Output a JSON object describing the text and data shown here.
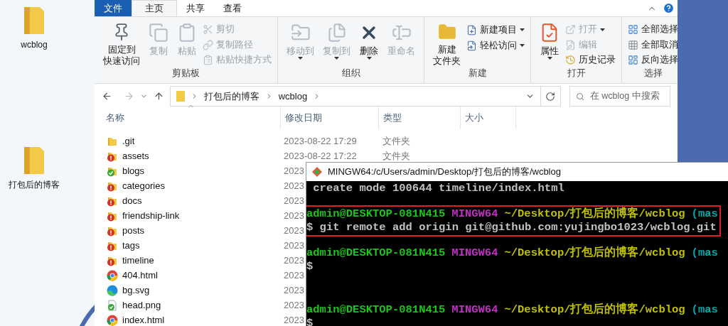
{
  "desktop_icons": [
    {
      "label": "wcblog"
    },
    {
      "label": "打包后的博客"
    }
  ],
  "explorer": {
    "tabs": [
      {
        "label": "文件",
        "kind": "file",
        "selected": false
      },
      {
        "label": "主页",
        "kind": "tab",
        "selected": true
      },
      {
        "label": "共享",
        "kind": "tab",
        "selected": false
      },
      {
        "label": "查看",
        "kind": "tab",
        "selected": false
      }
    ],
    "ribbon": {
      "groups": [
        {
          "label": "剪贴板",
          "buttons": [
            {
              "lines": [
                "固定到",
                "快速访问"
              ],
              "kind": "large",
              "disabled": false,
              "dropdown": false
            },
            {
              "lines": [
                "复制"
              ],
              "kind": "large",
              "disabled": true,
              "dropdown": false
            },
            {
              "lines": [
                "粘贴"
              ],
              "kind": "large",
              "disabled": true,
              "dropdown": false
            },
            {
              "lines": [
                "剪切"
              ],
              "kind": "small",
              "disabled": true,
              "dropdown": false
            },
            {
              "lines": [
                "复制路径"
              ],
              "kind": "small",
              "disabled": true,
              "dropdown": false
            },
            {
              "lines": [
                "粘贴快捷方式"
              ],
              "kind": "small",
              "disabled": true,
              "dropdown": false
            }
          ]
        },
        {
          "label": "组织",
          "buttons": [
            {
              "lines": [
                "移动到"
              ],
              "kind": "large",
              "disabled": true,
              "dropdown": true
            },
            {
              "lines": [
                "复制到"
              ],
              "kind": "large",
              "disabled": true,
              "dropdown": true
            },
            {
              "lines": [
                "删除"
              ],
              "kind": "large",
              "disabled": false,
              "dropdown": true
            },
            {
              "lines": [
                "重命名"
              ],
              "kind": "large",
              "disabled": true,
              "dropdown": false
            }
          ]
        },
        {
          "label": "新建",
          "buttons": [
            {
              "lines": [
                "新建",
                "文件夹"
              ],
              "kind": "large",
              "disabled": false,
              "dropdown": false
            },
            {
              "lines": [
                "新建项目"
              ],
              "kind": "small",
              "disabled": false,
              "dropdown": true
            },
            {
              "lines": [
                "轻松访问"
              ],
              "kind": "small",
              "disabled": false,
              "dropdown": true
            }
          ]
        },
        {
          "label": "打开",
          "buttons": [
            {
              "lines": [
                "属性"
              ],
              "kind": "large",
              "disabled": false,
              "dropdown": true
            },
            {
              "lines": [
                "打开"
              ],
              "kind": "small",
              "disabled": true,
              "dropdown": true
            },
            {
              "lines": [
                "编辑"
              ],
              "kind": "small",
              "disabled": true,
              "dropdown": false
            },
            {
              "lines": [
                "历史记录"
              ],
              "kind": "small",
              "disabled": false,
              "dropdown": false
            }
          ]
        },
        {
          "label": "选择",
          "buttons": [
            {
              "lines": [
                "全部选择"
              ],
              "kind": "small",
              "disabled": false,
              "dropdown": false
            },
            {
              "lines": [
                "全部取消"
              ],
              "kind": "small",
              "disabled": false,
              "dropdown": false
            },
            {
              "lines": [
                "反向选择"
              ],
              "kind": "small",
              "disabled": false,
              "dropdown": false
            }
          ]
        }
      ]
    },
    "breadcrumbs": [
      "打包后的博客",
      "wcblog"
    ],
    "search": {
      "placeholder": "在 wcblog 中搜索"
    },
    "columns": [
      "名称",
      "修改日期",
      "类型",
      "大小"
    ],
    "rows": [
      {
        "name": ".git",
        "kind": "folder",
        "date": "2023-08-22 17:29",
        "type": "文件夹"
      },
      {
        "name": "assets",
        "kind": "folder-error",
        "date": "2023-08-22 17:22",
        "type": "文件夹"
      },
      {
        "name": "blogs",
        "kind": "folder-ok",
        "date": "2023"
      },
      {
        "name": "categories",
        "kind": "folder-error",
        "date": "2023"
      },
      {
        "name": "docs",
        "kind": "folder-error",
        "date": "2023"
      },
      {
        "name": "friendship-link",
        "kind": "folder-error",
        "date": "2023"
      },
      {
        "name": "posts",
        "kind": "folder-error",
        "date": "2023"
      },
      {
        "name": "tags",
        "kind": "folder-error",
        "date": "2023"
      },
      {
        "name": "timeline",
        "kind": "folder-error",
        "date": "2023"
      },
      {
        "name": "404.html",
        "kind": "html",
        "date": "2023"
      },
      {
        "name": "bg.svg",
        "kind": "svg",
        "date": "2023"
      },
      {
        "name": "head.png",
        "kind": "image",
        "date": "2023"
      },
      {
        "name": "index.html",
        "kind": "html",
        "date": "2023"
      }
    ]
  },
  "terminal": {
    "title": "MINGW64:/c/Users/admin/Desktop/打包后的博客/wcblog",
    "lines": [
      {
        "kind": "text",
        "highlighted": false,
        "segments": [
          {
            "text": " create mode 100644 timeline/index.html",
            "kind": "output"
          }
        ]
      },
      {
        "kind": "blank",
        "highlighted": false
      },
      {
        "kind": "text",
        "highlighted": true,
        "segments": [
          {
            "text": "admin@DESKTOP-081N415",
            "kind": "user"
          },
          {
            "text": "MINGW64",
            "kind": "system"
          },
          {
            "text": "~/Desktop/打包后的博客/wcblog",
            "kind": "path"
          },
          {
            "text": "(mas",
            "kind": "branch"
          }
        ]
      },
      {
        "kind": "text",
        "highlighted": true,
        "segments": [
          {
            "text": "$ git remote add origin git@github.com:yujingbo1023/wcblog.git",
            "kind": "output"
          }
        ]
      },
      {
        "kind": "blank",
        "highlighted": false
      },
      {
        "kind": "text",
        "highlighted": false,
        "segments": [
          {
            "text": "admin@DESKTOP-081N415",
            "kind": "user"
          },
          {
            "text": "MINGW64",
            "kind": "system"
          },
          {
            "text": "~/Desktop/打包后的博客/wcblog",
            "kind": "path"
          },
          {
            "text": "(mas",
            "kind": "branch"
          }
        ]
      },
      {
        "kind": "text",
        "highlighted": false,
        "segments": [
          {
            "text": "$",
            "kind": "output"
          }
        ]
      },
      {
        "kind": "blank",
        "highlighted": false
      },
      {
        "kind": "blank",
        "highlighted": false
      },
      {
        "kind": "blank",
        "highlighted": false
      },
      {
        "kind": "text",
        "highlighted": false,
        "segments": [
          {
            "text": "admin@DESKTOP-081N415",
            "kind": "user"
          },
          {
            "text": "MINGW64",
            "kind": "system"
          },
          {
            "text": "~/Desktop/打包后的博客/wcblog",
            "kind": "path"
          },
          {
            "text": "(mas",
            "kind": "branch"
          }
        ]
      },
      {
        "kind": "text",
        "highlighted": false,
        "segments": [
          {
            "text": "$",
            "kind": "output"
          }
        ]
      }
    ]
  }
}
